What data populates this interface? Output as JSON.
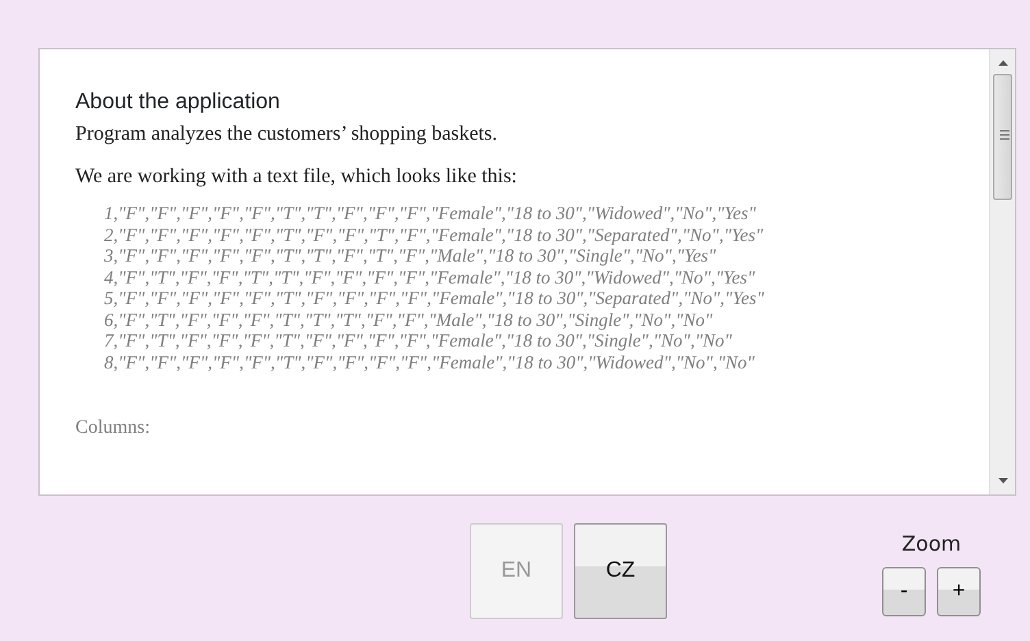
{
  "document": {
    "heading": "About the application",
    "paragraphs": [
      "Program analyzes the customers’ shopping baskets.",
      "We are working with a text file, which looks like this:"
    ],
    "sample_lines": [
      "1,\"F\",\"F\",\"F\",\"F\",\"F\",\"T\",\"T\",\"F\",\"F\",\"F\",\"Female\",\"18 to 30\",\"Widowed\",\"No\",\"Yes\"",
      "2,\"F\",\"F\",\"F\",\"F\",\"F\",\"T\",\"F\",\"F\",\"T\",\"F\",\"Female\",\"18 to 30\",\"Separated\",\"No\",\"Yes\"",
      "3,\"F\",\"F\",\"F\",\"F\",\"F\",\"T\",\"T\",\"F\",\"T\",\"F\",\"Male\",\"18 to 30\",\"Single\",\"No\",\"Yes\"",
      "4,\"F\",\"T\",\"F\",\"F\",\"T\",\"T\",\"F\",\"F\",\"F\",\"F\",\"Female\",\"18 to 30\",\"Widowed\",\"No\",\"Yes\"",
      "5,\"F\",\"F\",\"F\",\"F\",\"F\",\"T\",\"F\",\"F\",\"F\",\"F\",\"Female\",\"18 to 30\",\"Separated\",\"No\",\"Yes\"",
      "6,\"F\",\"T\",\"F\",\"F\",\"F\",\"T\",\"T\",\"T\",\"F\",\"F\",\"Male\",\"18 to 30\",\"Single\",\"No\",\"No\"",
      "7,\"F\",\"T\",\"F\",\"F\",\"F\",\"T\",\"F\",\"F\",\"F\",\"F\",\"Female\",\"18 to 30\",\"Single\",\"No\",\"No\"",
      "8,\"F\",\"F\",\"F\",\"F\",\"F\",\"T\",\"F\",\"F\",\"F\",\"F\",\"Female\",\"18 to 30\",\"Widowed\",\"No\",\"No\""
    ],
    "columns_label": "Columns:"
  },
  "language_buttons": [
    {
      "label": "EN",
      "disabled": true
    },
    {
      "label": "CZ",
      "disabled": false
    }
  ],
  "zoom": {
    "label": "Zoom",
    "buttons": [
      "-",
      "+"
    ]
  }
}
